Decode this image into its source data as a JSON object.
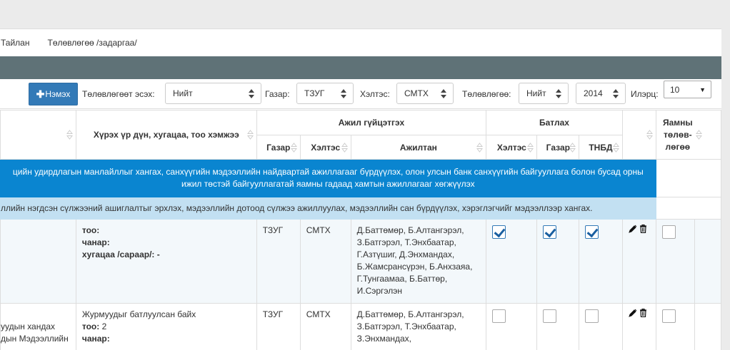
{
  "nav": {
    "report": "Тайлан",
    "plan": "Төлөвлөгөө /задаргаа/"
  },
  "filters": {
    "add_label": "Нэмэх",
    "is_planned_label": "Төлөвлөгөөт эсэх:",
    "is_planned_value": "Нийт",
    "place_label": "Газар:",
    "place_value": "ТЗУГ",
    "dept_label": "Хэлтэс:",
    "dept_value": "СМТХ",
    "plan_label": "Төлөвлөгөө:",
    "plan_value": "Нийт",
    "year_value": "2014",
    "count_label": "Илэрц:",
    "count_value": "10"
  },
  "headers": {
    "result": "Хүрэх үр дүн, хугацаа, тоо хэмжээ",
    "executor": "Ажил гүйцэтгэх",
    "approve": "Батлах",
    "not_planned": "Яамны төлөв-лөгөө",
    "place": "Газар",
    "dept": "Хэлтэс",
    "employee": "Ажилтан",
    "a_dept": "Хэлтэс",
    "a_place": "Газар",
    "a_tnbd": "ТНБД"
  },
  "goal_band": "цийн удирдлагын манлайллыг хангах, санхүүгийн мэдээллийн найдвартай ажиллагааг бүрдүүлэх, олон улсын банк санхүүгийн байгууллага болон бусад орны ижил төстэй байгууллагатай яамны гадаад хамтын ажиллагааг хөгжүүлэх",
  "objective_band": "ллийн нэгдсэн сүлжээний ашиглалтыг эрхлэх, мэдээллийн дотоод сүлжээ ажиллуулах, мэдээллийн сан бүрдүүлэх, хэрэглэгчийг мэдээллээр хангах.",
  "rows": [
    {
      "left": [],
      "result_title": "",
      "too": "тоо:",
      "too_val": "",
      "chanar": "чанар:",
      "hugatsaa": "хугацаа /сараар/: -",
      "place": "ТЗУГ",
      "dept": "СМТХ",
      "employees": "Д.Баттөмөр, Б.Алтангэрэл, З.Батгэрэл, Т.Энхбаатар, Г.Азтүшиг, Д.Энхмандах, Б.Жамсрансүрэн, Б.Анхзаяа, Г.Тунгаамаа, Б.Баттөр, И.Сэргэлэн",
      "approved": [
        true,
        true,
        true
      ]
    },
    {
      "left": [
        "уудын хандах",
        "дын Мэдээллийн"
      ],
      "result_title": "Журмуудыг батлуулсан байх",
      "too": "тоо:",
      "too_val": " 2",
      "chanar": "чанар:",
      "hugatsaa": "",
      "place": "ТЗУГ",
      "dept": "СМТХ",
      "employees": "Д.Баттөмөр, Б.Алтангэрэл, З.Батгэрэл, Т.Энхбаатар, З.Энхмандах,",
      "approved": [
        false,
        false,
        false
      ]
    }
  ]
}
